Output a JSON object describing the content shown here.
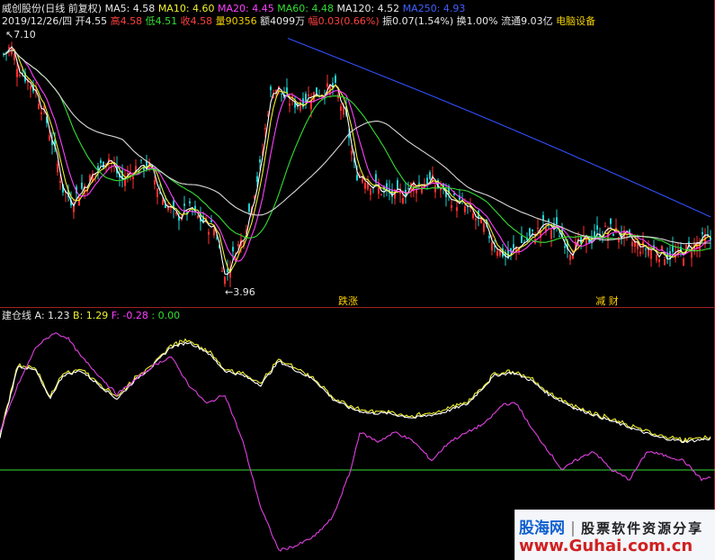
{
  "info_bar": {
    "stock": "威创股份(日线 前复权)",
    "ma": [
      {
        "label": "MA5: 4.58",
        "color": "#ffffff"
      },
      {
        "label": "MA10: 4.60",
        "color": "#f0f030"
      },
      {
        "label": "MA20: 4.45",
        "color": "#ff40ff"
      },
      {
        "label": "MA60: 4.48",
        "color": "#33dd33"
      },
      {
        "label": "MA120: 4.52",
        "color": "#e8e8e8"
      },
      {
        "label": "MA250: 4.93",
        "color": "#3050ff"
      }
    ]
  },
  "detail_bar": {
    "date": "2019/12/26/四",
    "open": "开4.55",
    "high": "高4.58",
    "low": "低4.51",
    "close": "收4.58",
    "volume": "量90356",
    "amount": "额4099万",
    "change": "幅0.03(0.66%)",
    "amplitude": "振0.07(1.54%)",
    "turnover": "换1.00%",
    "float": "流通9.03亿",
    "sector": "电脑设备"
  },
  "main_panel": {
    "high_marker": "7.10",
    "low_marker": "3.96",
    "event_tags": [
      {
        "text": "跌涨",
        "x": 387
      },
      {
        "text": "减 财",
        "x": 675
      }
    ]
  },
  "indicator_panel": {
    "title": "建仓线",
    "a": "A: 1.23",
    "b": "B: 1.29",
    "f": "F: -0.28",
    "zero": ": 0.00"
  },
  "watermark": {
    "brand": "股海网",
    "tagline": "股票软件资源分享",
    "url": "www.Guhai.com.cn"
  },
  "chart_data": [
    {
      "type": "candlestick",
      "title": "威创股份(日线 前复权)",
      "ylim": [
        3.96,
        7.1
      ],
      "series": [
        {
          "name": "MA5",
          "color": "#ffffff"
        },
        {
          "name": "MA10",
          "color": "#f0f030"
        },
        {
          "name": "MA20",
          "color": "#ff40ff"
        },
        {
          "name": "MA60",
          "color": "#33dd33"
        },
        {
          "name": "MA120",
          "color": "#e8e8e8"
        },
        {
          "name": "MA250",
          "color": "#3050ff"
        }
      ],
      "annotations": [
        "7.10",
        "3.96"
      ]
    },
    {
      "type": "line",
      "title": "建仓线",
      "series": [
        {
          "name": "A",
          "last": 1.23,
          "color": "#ffffff"
        },
        {
          "name": "B",
          "last": 1.29,
          "color": "#f0f030"
        },
        {
          "name": "F",
          "last": -0.28,
          "color": "#ff40ff"
        }
      ],
      "baseline": 0.0
    }
  ]
}
